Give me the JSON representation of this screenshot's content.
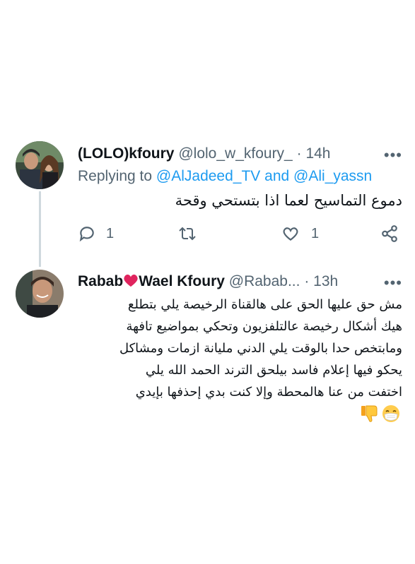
{
  "tweet1": {
    "display_name": "(LOLO)kfoury",
    "handle": "@lolo_w_kfoury_",
    "separator": "·",
    "time": "14h",
    "more_label": "•••",
    "replying_prefix": "Replying to",
    "mention_1": "@AlJadeed_TV",
    "replying_and": "and",
    "mention_2": "@Ali_yassn",
    "text": "دموع التماسيح لعما اذا بتستحي وقحة",
    "reply_count": "1",
    "like_count": "1",
    "icons": [
      "reply-icon",
      "retweet-icon",
      "like-icon",
      "share-icon"
    ]
  },
  "tweet2": {
    "display_name_part1": "Rabab",
    "display_name_part2": "Wael Kfoury",
    "handle": "@Rabab...",
    "separator": "·",
    "time": "13h",
    "more_label": "•••",
    "text_lines": [
      "مش حق عليها الحق على هالقناة الرخيصة يلي بتطلع",
      "هيك أشكال رخيصة عالتلفزيون وتحكي بمواضيع تافهة",
      "ومابتخص حدا بالوقت يلي الدني مليانة ازمات ومشاكل",
      "يحكو فيها إعلام فاسد بيلحق الترند الحمد الله يلي",
      "اختفت من عنا هالمحطة وإلا كنت بدي إحذفها بإيدي"
    ],
    "emojis": [
      "thumbs-down-emoji",
      "mask-face-emoji"
    ]
  }
}
